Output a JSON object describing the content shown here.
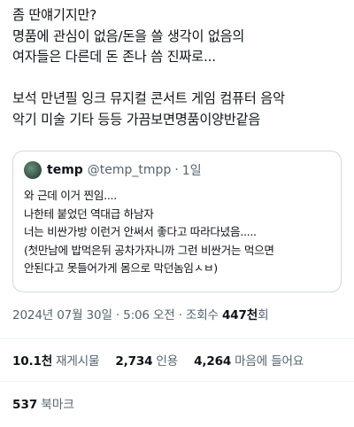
{
  "tweet": {
    "lines": [
      "좀 딴얘기지만?",
      "명품에 관심이 없음/돈을 쓸 생각이 없음의",
      "여자들은 다른데 돈 존나 씀 진짜로...",
      "",
      "보석 만년필 잉크 뮤지컬 콘서트 게임 컴퓨터 음악",
      "악기 미술 기타 등등 가끔보면명품이양반같음"
    ]
  },
  "quote": {
    "name": "temp",
    "handle": "@temp_tmpp",
    "dot": "·",
    "time": "1일",
    "lines": [
      "와 근데 이거 찐임....",
      "나한테 붙었던 역대급 하남자",
      "너는 비싼가방 이런거 안써서 좋다고 따라다녔음.....",
      "(첫만남에 밥먹은뒤 공차가자니까 그런 비싼거는 먹으면",
      "안된다고 못들어가게 몸으로 막던놈임ㅅㅂ)"
    ]
  },
  "meta": {
    "datetime": "2024년 07월 30일 · 5:06 오전 · 조회수 ",
    "views": "447천",
    "views_suffix": "회"
  },
  "stats": {
    "reposts_count": "10.1천",
    "reposts_label": "재게시물",
    "quotes_count": "2,734",
    "quotes_label": "인용",
    "likes_count": "4,264",
    "likes_label": "마음에 들어요",
    "bookmarks_count": "537",
    "bookmarks_label": "북마크"
  },
  "colors": {
    "text": "#0f1419",
    "secondary": "#536471",
    "border": "#cfd9de",
    "divider": "#eff3f4"
  }
}
